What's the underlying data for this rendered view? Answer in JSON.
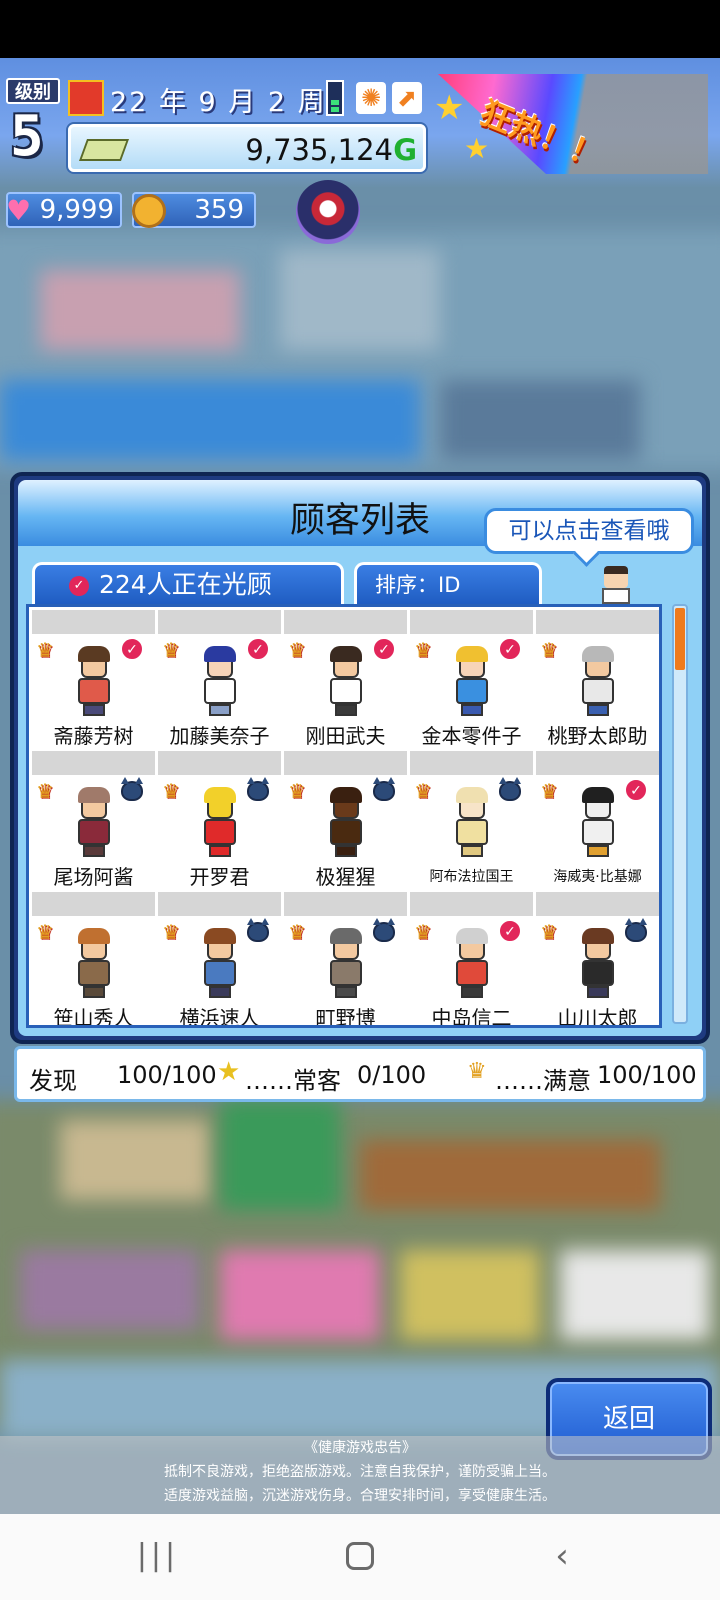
{
  "hud": {
    "level_label": "级别",
    "level": "5",
    "date": "22 年  9 月  2 周",
    "money": "9,735,124",
    "money_unit": "G",
    "gems": "9,999",
    "coins": "359",
    "fever": "狂热！！"
  },
  "panel": {
    "title": "顾客列表",
    "tip": "可以点击查看哦",
    "tab_visiting": "224人正在光顾",
    "tab_sort": "排序：ID",
    "customers": [
      {
        "name": "斋藤芳树",
        "badge": "visit",
        "skin": "#f3c9a0",
        "hair": "#5a3a22",
        "shirt": "#e05a4a",
        "legs": "#4a4a7a"
      },
      {
        "name": "加藤美奈子",
        "badge": "visit",
        "skin": "#f7d4b8",
        "hair": "#2a3aa0",
        "shirt": "#ffffff",
        "legs": "#8aa0c8"
      },
      {
        "name": "刚田武夫",
        "badge": "visit",
        "skin": "#f3c9a0",
        "hair": "#3a2a20",
        "shirt": "#ffffff",
        "legs": "#3a3a3a"
      },
      {
        "name": "金本零件子",
        "badge": "visit",
        "skin": "#f7d4b8",
        "hair": "#f0c030",
        "shirt": "#3a90e0",
        "legs": "#3a5ab0"
      },
      {
        "name": "桃野太郎助",
        "badge": "none",
        "skin": "#f3c9a0",
        "hair": "#b8b8b8",
        "shirt": "#e8e8e8",
        "legs": "#3a60b0"
      },
      {
        "name": "尾场阿酱",
        "badge": "devil",
        "skin": "#f3c9a0",
        "hair": "#a07a6a",
        "shirt": "#8a2a3a",
        "legs": "#5a3a3a"
      },
      {
        "name": "开罗君",
        "badge": "devil",
        "skin": "#f2d02a",
        "hair": "#f2d02a",
        "shirt": "#e02a2a",
        "legs": "#e02a2a"
      },
      {
        "name": "极猩猩",
        "badge": "devil",
        "skin": "#6a3a1a",
        "hair": "#3a2010",
        "shirt": "#4a2a10",
        "legs": "#3a2010"
      },
      {
        "name": "阿布法拉国王",
        "badge": "devil",
        "skin": "#f7e4c8",
        "hair": "#f0e0b0",
        "shirt": "#f0e0a0",
        "legs": "#e0c880"
      },
      {
        "name": "海威夷·比基娜",
        "badge": "visit",
        "skin": "#f0f0f0",
        "hair": "#202020",
        "shirt": "#f0f0f0",
        "legs": "#e0a030"
      },
      {
        "name": "笹山秀人",
        "badge": "none",
        "skin": "#f3c9a0",
        "hair": "#c07030",
        "shirt": "#8a6a4a",
        "legs": "#5a4a3a"
      },
      {
        "name": "横浜速人",
        "badge": "devil",
        "skin": "#f3c9a0",
        "hair": "#8a4a22",
        "shirt": "#4a7ac0",
        "legs": "#3a3a5a"
      },
      {
        "name": "町野博",
        "badge": "devil",
        "skin": "#f3c9a0",
        "hair": "#6a6a6a",
        "shirt": "#8a7a6a",
        "legs": "#4a4a4a"
      },
      {
        "name": "中岛信二",
        "badge": "visit",
        "skin": "#f3c9a0",
        "hair": "#d0d0d0",
        "shirt": "#e04a3a",
        "legs": "#3a3a3a"
      },
      {
        "name": "山川太郎",
        "badge": "devil",
        "skin": "#f3c9a0",
        "hair": "#6a3a22",
        "shirt": "#2a2a2a",
        "legs": "#3a3a5a"
      }
    ]
  },
  "stats": {
    "found_label": "发现",
    "found_value": "100/100",
    "regular_label": "……常客",
    "regular_value": "0/100",
    "satisfied_label": "……满意",
    "satisfied_value": "100/100"
  },
  "back_label": "返回",
  "health_notice": {
    "title": "《健康游戏忠告》",
    "line1": "抵制不良游戏，拒绝盗版游戏。注意自我保护，谨防受骗上当。",
    "line2": "适度游戏益脑，沉迷游戏伤身。合理安排时间，享受健康生活。"
  },
  "icons": {
    "date": "calendar-icon",
    "speed": "speed-indicator-icon",
    "weather": "sun-icon",
    "boost": "boost-arrow-icon",
    "money": "banknote-icon",
    "gem": "gem-icon",
    "coin": "coin-icon",
    "shield": "shield-icon",
    "crown": "crown-icon",
    "star": "star-icon"
  },
  "scroll": {
    "position": 0.0,
    "visible_fraction": 0.15
  }
}
